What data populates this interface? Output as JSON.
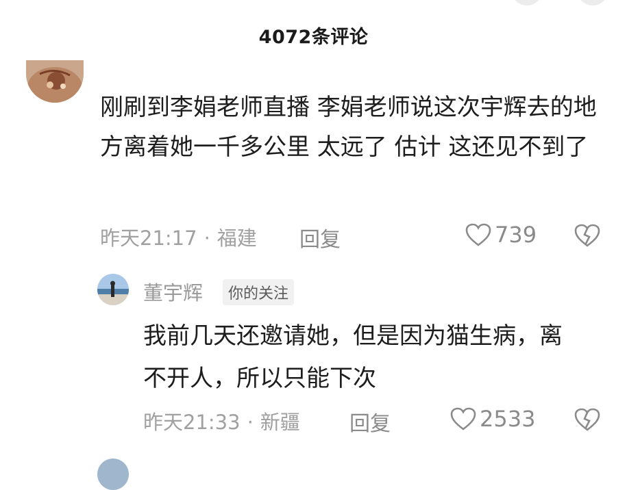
{
  "header": {
    "comment_count": "4072条评论"
  },
  "comments": [
    {
      "avatar_icon": "user-avatar-icon",
      "text": "刚刷到李娟老师直播  李娟老师说这次宇辉去的地方离着她一千多公里 太远了 估计 这还见不到了",
      "time": "昨天21:17",
      "location": "福建",
      "reply_label": "回复",
      "likes": "739"
    }
  ],
  "replies": [
    {
      "username": "董宇辉",
      "tag": "你的关注",
      "text": "我前几天还邀请她，但是因为猫生病，离不开人，所以只能下次",
      "time": "昨天21:33",
      "location": "新疆",
      "reply_label": "回复",
      "likes": "2533"
    }
  ],
  "colors": {
    "meta_gray": "#a0a0a0",
    "icon_gray": "#8a8a8a",
    "tag_bg": "#f1f1f1"
  }
}
